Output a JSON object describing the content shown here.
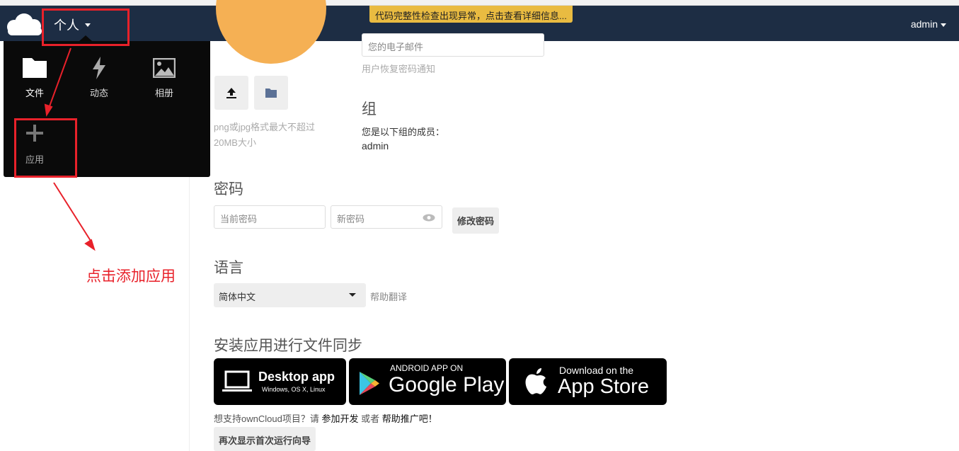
{
  "header": {
    "app_name": "个人",
    "warning": "代码完整性检查出现异常，点击查看详细信息...",
    "user": "admin"
  },
  "menu": {
    "items": [
      {
        "label": "文件",
        "icon": "folder-icon"
      },
      {
        "label": "动态",
        "icon": "lightning-icon"
      },
      {
        "label": "相册",
        "icon": "image-icon"
      },
      {
        "label": "应用",
        "icon": "plus-icon"
      }
    ]
  },
  "profile": {
    "email_placeholder": "您的电子邮件",
    "email_hint": "用户恢复密码通知",
    "avatar_hint_1": "png或jpg格式最大不超过",
    "avatar_hint_2": "20MB大小",
    "avatar_color": "#f5b054",
    "groups_title": "组",
    "groups_text": "您是以下组的成员：",
    "groups_value": "admin",
    "password_title": "密码",
    "current_password_placeholder": "当前密码",
    "new_password_placeholder": "新密码",
    "change_password_button": "修改密码",
    "language_title": "语言",
    "language_value": "简体中文",
    "help_translate": "帮助翻译",
    "sync_title": "安装应用进行文件同步",
    "desktop_title": "Desktop app",
    "desktop_sub": "Windows, OS X, Linux",
    "android_top": "ANDROID APP ON",
    "android_main": "Google Play",
    "ios_top": "Download on the",
    "ios_main": "App Store",
    "support_prefix": "想支持ownCloud项目？请 ",
    "support_link1": "参加开发",
    "support_mid": " 或者 ",
    "support_link2": "帮助推广吧！",
    "wizard_button": "再次显示首次运行向导"
  },
  "annotation": {
    "text": "点击添加应用",
    "color": "#e8212a"
  }
}
